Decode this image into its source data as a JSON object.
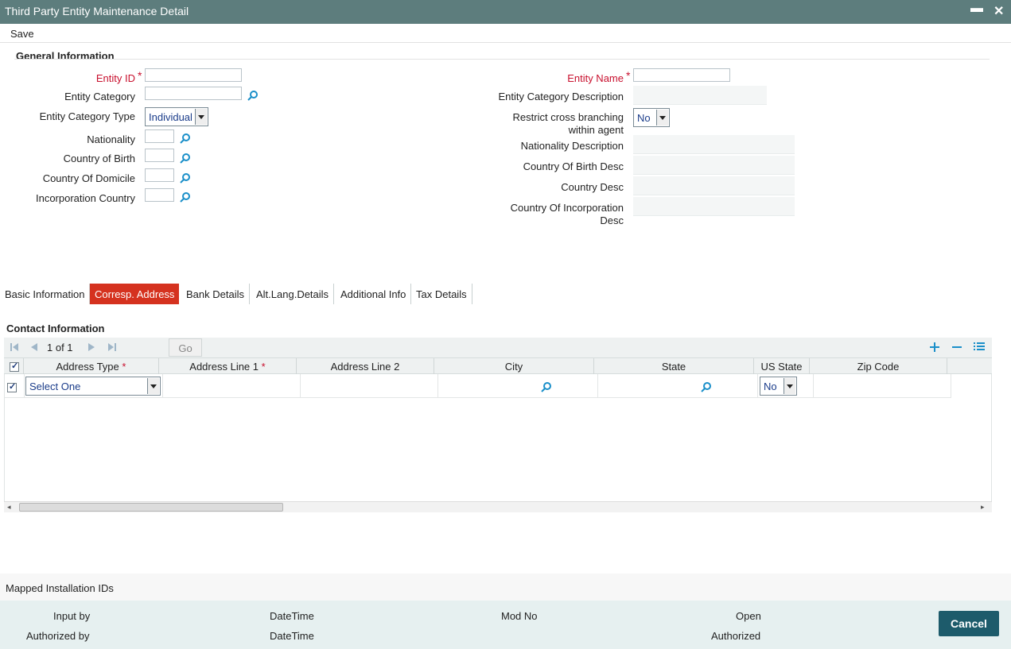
{
  "window": {
    "title": "Third Party Entity Maintenance Detail",
    "minimize": "▬",
    "close": "✕"
  },
  "toolbar": {
    "save_label": "Save"
  },
  "general": {
    "title": "General Information",
    "entity_id_label": "Entity ID",
    "entity_category_label": "Entity Category",
    "entity_category_type_label": "Entity Category Type",
    "entity_category_type_value": "Individual",
    "nationality_label": "Nationality",
    "country_of_birth_label": "Country of Birth",
    "country_of_domicile_label": "Country Of Domicile",
    "incorporation_country_label": "Incorporation Country",
    "entity_name_label": "Entity Name",
    "entity_category_desc_label": "Entity Category Description",
    "restrict_line1": "Restrict cross branching",
    "restrict_line2": "within agent",
    "restrict_value": "No",
    "nationality_desc_label": "Nationality Description",
    "country_of_birth_desc_label": "Country Of Birth Desc",
    "country_desc_label": "Country Desc",
    "country_inc_desc_line1": "Country Of Incorporation",
    "country_inc_desc_line2": "Desc",
    "required_mark": "*"
  },
  "tabs": [
    {
      "label": "Basic Information"
    },
    {
      "label": "Corresp. Address"
    },
    {
      "label": "Bank Details"
    },
    {
      "label": "Alt.Lang.Details"
    },
    {
      "label": "Additional Info"
    },
    {
      "label": "Tax Details"
    }
  ],
  "active_tab": "Corresp. Address",
  "contact": {
    "title": "Contact Information",
    "pager": "1 of 1",
    "go_label": "Go",
    "columns": [
      "Address Type",
      "Address Line 1",
      "Address Line 2",
      "City",
      "State",
      "US State",
      "Zip Code"
    ],
    "row": {
      "address_type": "Select One",
      "us_state": "No"
    }
  },
  "footer": {
    "mapped_label": "Mapped Installation IDs",
    "input_by": "Input by",
    "authorized_by": "Authorized by",
    "datetime1": "DateTime",
    "datetime2": "DateTime",
    "mod_no": "Mod No",
    "open": "Open",
    "authorized": "Authorized",
    "cancel_label": "Cancel"
  },
  "colors": {
    "titlebar": "#5d7d7d",
    "active_tab": "#d5321f",
    "required": "#c8102e",
    "cancel_button": "#1d5b6b"
  },
  "icons": [
    "search-icon",
    "first-page-icon",
    "prev-page-icon",
    "next-page-icon",
    "last-page-icon",
    "add-row-icon",
    "delete-row-icon",
    "list-view-icon"
  ]
}
